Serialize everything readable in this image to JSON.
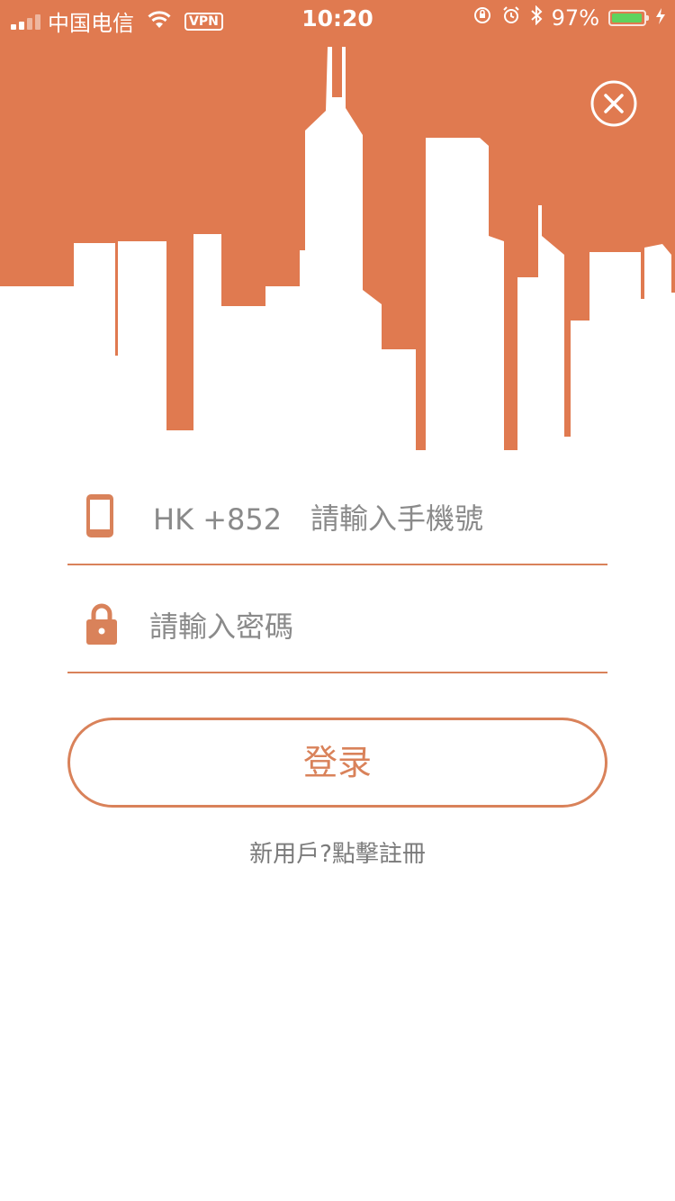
{
  "status_bar": {
    "carrier": "中国电信",
    "vpn_label": "VPN",
    "time": "10:20",
    "battery_percent_label": "97%",
    "battery_level": 0.97
  },
  "header": {
    "background_color": "#e07a50",
    "close_icon": "close-circle-icon"
  },
  "form": {
    "phone": {
      "icon": "phone-icon",
      "country_prefix": "HK +852",
      "placeholder": "請輸入手機號",
      "value": ""
    },
    "password": {
      "icon": "lock-icon",
      "placeholder": "請輸入密碼",
      "value": ""
    },
    "login_button_label": "登录",
    "register_link": "新用戶?點擊註冊"
  },
  "colors": {
    "accent": "#d9825a",
    "hint_text": "#8a8a8a"
  }
}
